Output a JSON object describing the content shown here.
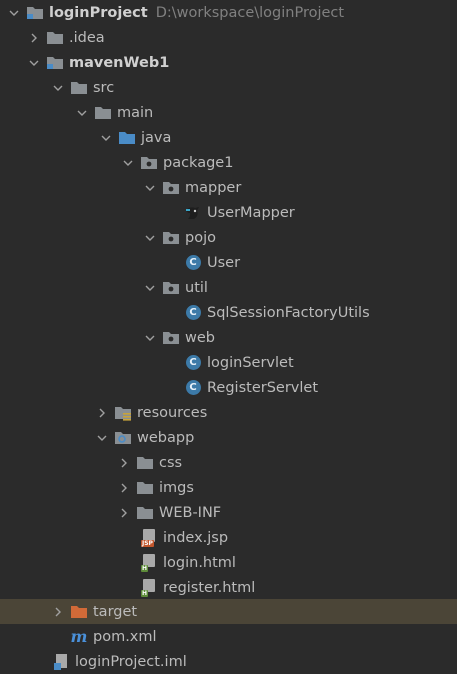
{
  "project": {
    "name": "loginProject",
    "path": "D:\\workspace\\loginProject"
  },
  "tree": [
    {
      "label": "loginProject",
      "icon": "project-folder-icon",
      "expanded": true
    },
    {
      "label": ".idea",
      "icon": "folder-icon",
      "expanded": false
    },
    {
      "label": "mavenWeb1",
      "icon": "module-folder-icon",
      "expanded": true
    },
    {
      "label": "src",
      "icon": "folder-icon",
      "expanded": true
    },
    {
      "label": "main",
      "icon": "folder-icon",
      "expanded": true
    },
    {
      "label": "java",
      "icon": "source-folder-icon",
      "expanded": true
    },
    {
      "label": "package1",
      "icon": "package-icon",
      "expanded": true
    },
    {
      "label": "mapper",
      "icon": "package-icon",
      "expanded": true
    },
    {
      "label": "UserMapper",
      "icon": "mybatis-interface-icon"
    },
    {
      "label": "pojo",
      "icon": "package-icon",
      "expanded": true
    },
    {
      "label": "User",
      "icon": "class-icon"
    },
    {
      "label": "util",
      "icon": "package-icon",
      "expanded": true
    },
    {
      "label": "SqlSessionFactoryUtils",
      "icon": "class-icon"
    },
    {
      "label": "web",
      "icon": "package-icon",
      "expanded": true
    },
    {
      "label": "loginServlet",
      "icon": "class-icon"
    },
    {
      "label": "RegisterServlet",
      "icon": "class-icon"
    },
    {
      "label": "resources",
      "icon": "resources-folder-icon",
      "expanded": false
    },
    {
      "label": "webapp",
      "icon": "web-folder-icon",
      "expanded": true
    },
    {
      "label": "css",
      "icon": "folder-icon",
      "expanded": false
    },
    {
      "label": "imgs",
      "icon": "folder-icon",
      "expanded": false
    },
    {
      "label": "WEB-INF",
      "icon": "folder-icon",
      "expanded": false
    },
    {
      "label": "index.jsp",
      "icon": "jsp-file-icon"
    },
    {
      "label": "login.html",
      "icon": "html-file-icon"
    },
    {
      "label": "register.html",
      "icon": "html-file-icon"
    },
    {
      "label": "target",
      "icon": "excluded-folder-icon",
      "expanded": false
    },
    {
      "label": "pom.xml",
      "icon": "maven-pom-icon"
    },
    {
      "label": "loginProject.iml",
      "icon": "iml-file-icon"
    }
  ],
  "icon_text": {
    "class": "C",
    "jsp": "JSP",
    "html": "H",
    "maven": "m"
  },
  "colors": {
    "background": "#2b2b2b",
    "selected_row": "#4b4537",
    "folder": "#8a8f93",
    "source_folder": "#4a8cc7",
    "excluded_folder": "#d16a38",
    "class_icon": "#3c7aa8",
    "text": "#bbbbbb",
    "path_text": "#808080"
  }
}
